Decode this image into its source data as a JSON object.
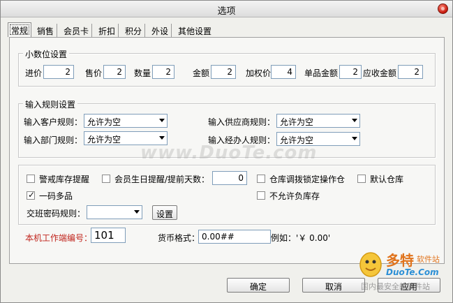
{
  "window": {
    "title": "选项"
  },
  "tabs": [
    "常规",
    "销售",
    "会员卡",
    "折扣",
    "积分",
    "外设",
    "其他设置"
  ],
  "decimals": {
    "title": "小数位设置",
    "fields": [
      {
        "label": "进价",
        "value": "2"
      },
      {
        "label": "售价",
        "value": "2"
      },
      {
        "label": "数量",
        "value": "2"
      },
      {
        "label": "金额",
        "value": "2"
      },
      {
        "label": "加权价",
        "value": "4"
      },
      {
        "label": "单品金额",
        "value": "2"
      },
      {
        "label": "应收金额",
        "value": "2"
      }
    ]
  },
  "rules": {
    "title": "输入规则设置",
    "customer": {
      "label": "输入客户规则：",
      "value": "允许为空"
    },
    "supplier": {
      "label": "输入供应商规则：",
      "value": "允许为空"
    },
    "department": {
      "label": "输入部门规则：",
      "value": "允许为空"
    },
    "handler": {
      "label": "输入经办人规则：",
      "value": "允许为空"
    }
  },
  "options": {
    "stock_alert": {
      "label": "警戒库存提醒",
      "checked": false
    },
    "birthday": {
      "label": "会员生日提醒/提前天数：",
      "checked": false,
      "days": "0"
    },
    "lock_transfer": {
      "label": "仓库调拨锁定操作仓",
      "checked": false
    },
    "default_warehouse": {
      "label": "默认仓库",
      "checked": false
    },
    "multi_barcode": {
      "label": "一码多品",
      "checked": true
    },
    "no_negative_stock": {
      "label": "不允许负库存",
      "checked": false
    },
    "shift_password": {
      "label": "交班密码规则：",
      "value": ""
    },
    "setup_label": "设置"
  },
  "terminal": {
    "label": "本机工作端编号：",
    "value": "101",
    "label_color": "#c0241c"
  },
  "currency": {
    "label": "货币格式：",
    "value": "0.00##",
    "example": "例如：'￥ 0.00'"
  },
  "buttons": {
    "ok": "确定",
    "cancel": "取消",
    "apply": "应用"
  },
  "watermark": "www.DuoTe.com",
  "logo": {
    "brand": "多特",
    "tag": "软件站",
    "url": "DuoTe.Com",
    "slogan": "国内最安全的软件站"
  }
}
